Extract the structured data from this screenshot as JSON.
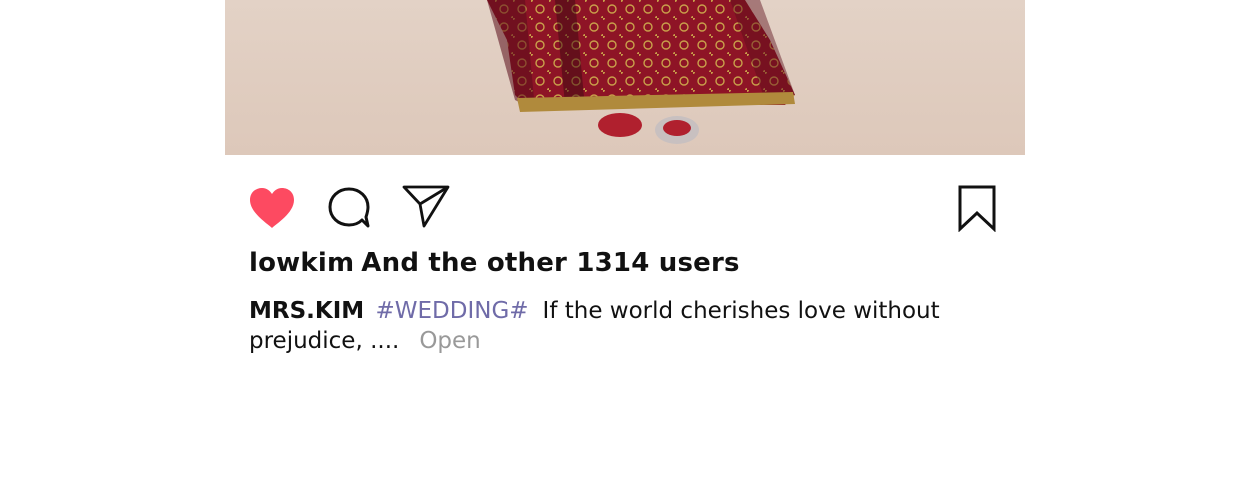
{
  "post": {
    "image": {
      "description_icon": "photo"
    },
    "actions": {
      "like_icon": "heart-icon",
      "comment_icon": "comment-bubble-icon",
      "share_icon": "send-paper-plane-icon",
      "save_icon": "bookmark-icon",
      "like_color": "#fd4a61"
    },
    "likes": {
      "user": "lowkim",
      "rest": "And the other 1314 users"
    },
    "caption": {
      "author": "MRS.KIM",
      "hashtag": "#WEDDING#",
      "text": "If the world cherishes love without prejudice, ....",
      "more_label": "Open"
    },
    "colors": {
      "hashtag": "#6f6ba8",
      "more": "#999999",
      "photo_bg": "#e0cdbf"
    }
  }
}
